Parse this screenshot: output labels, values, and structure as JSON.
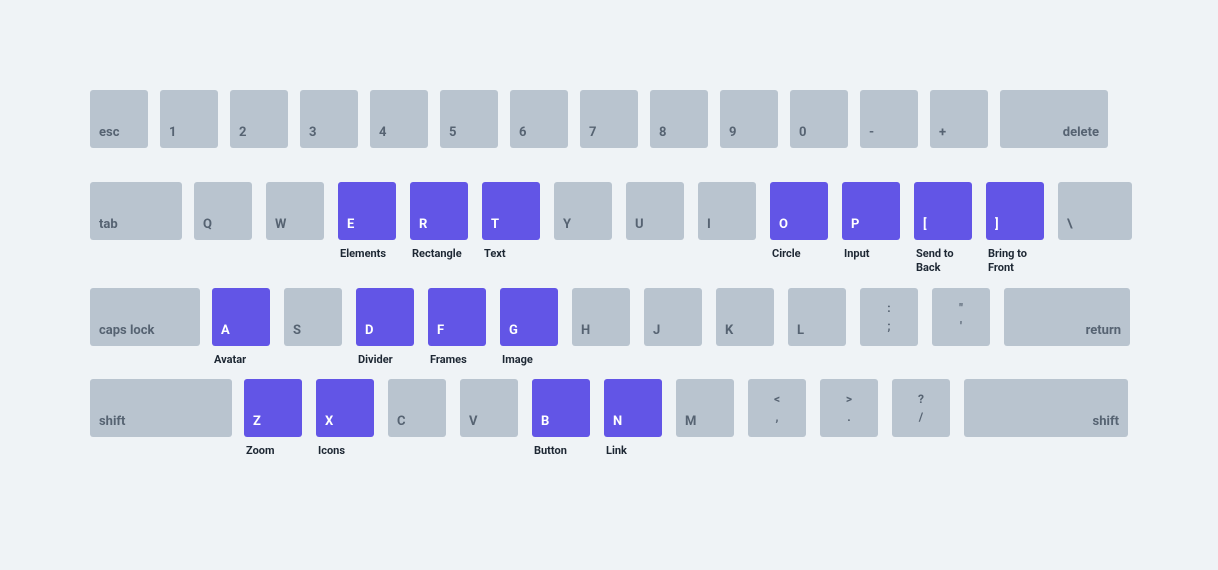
{
  "rows": [
    {
      "keys": [
        {
          "id": "esc",
          "cap": "esc",
          "width": 58,
          "active": false,
          "action": ""
        },
        {
          "id": "1",
          "cap": "1",
          "width": 58,
          "active": false,
          "action": ""
        },
        {
          "id": "2",
          "cap": "2",
          "width": 58,
          "active": false,
          "action": ""
        },
        {
          "id": "3",
          "cap": "3",
          "width": 58,
          "active": false,
          "action": ""
        },
        {
          "id": "4",
          "cap": "4",
          "width": 58,
          "active": false,
          "action": ""
        },
        {
          "id": "5",
          "cap": "5",
          "width": 58,
          "active": false,
          "action": ""
        },
        {
          "id": "6",
          "cap": "6",
          "width": 58,
          "active": false,
          "action": ""
        },
        {
          "id": "7",
          "cap": "7",
          "width": 58,
          "active": false,
          "action": ""
        },
        {
          "id": "8",
          "cap": "8",
          "width": 58,
          "active": false,
          "action": ""
        },
        {
          "id": "9",
          "cap": "9",
          "width": 58,
          "active": false,
          "action": ""
        },
        {
          "id": "0",
          "cap": "0",
          "width": 58,
          "active": false,
          "action": ""
        },
        {
          "id": "minus",
          "cap": "-",
          "width": 58,
          "active": false,
          "action": ""
        },
        {
          "id": "plus",
          "cap": "+",
          "width": 58,
          "active": false,
          "action": ""
        },
        {
          "id": "delete",
          "cap": "delete",
          "width": 108,
          "active": false,
          "action": "",
          "alignRight": true
        }
      ]
    },
    {
      "keys": [
        {
          "id": "tab",
          "cap": "tab",
          "width": 92,
          "active": false,
          "action": ""
        },
        {
          "id": "Q",
          "cap": "Q",
          "width": 58,
          "active": false,
          "action": ""
        },
        {
          "id": "W",
          "cap": "W",
          "width": 58,
          "active": false,
          "action": ""
        },
        {
          "id": "E",
          "cap": "E",
          "width": 58,
          "active": true,
          "action": "Elements"
        },
        {
          "id": "R",
          "cap": "R",
          "width": 58,
          "active": true,
          "action": "Rectangle"
        },
        {
          "id": "T",
          "cap": "T",
          "width": 58,
          "active": true,
          "action": "Text"
        },
        {
          "id": "Y",
          "cap": "Y",
          "width": 58,
          "active": false,
          "action": ""
        },
        {
          "id": "U",
          "cap": "U",
          "width": 58,
          "active": false,
          "action": ""
        },
        {
          "id": "I",
          "cap": "I",
          "width": 58,
          "active": false,
          "action": ""
        },
        {
          "id": "O",
          "cap": "O",
          "width": 58,
          "active": true,
          "action": "Circle"
        },
        {
          "id": "P",
          "cap": "P",
          "width": 58,
          "active": true,
          "action": "Input"
        },
        {
          "id": "bracket-open",
          "cap": "[",
          "width": 58,
          "active": true,
          "action": "Send to Back"
        },
        {
          "id": "bracket-close",
          "cap": "]",
          "width": 58,
          "active": true,
          "action": "Bring to Front"
        },
        {
          "id": "backslash",
          "cap": "\\",
          "width": 74,
          "active": false,
          "action": ""
        }
      ]
    },
    {
      "keys": [
        {
          "id": "caps-lock",
          "cap": "caps lock",
          "width": 110,
          "active": false,
          "action": ""
        },
        {
          "id": "A",
          "cap": "A",
          "width": 58,
          "active": true,
          "action": "Avatar"
        },
        {
          "id": "S",
          "cap": "S",
          "width": 58,
          "active": false,
          "action": ""
        },
        {
          "id": "D",
          "cap": "D",
          "width": 58,
          "active": true,
          "action": "Divider"
        },
        {
          "id": "F",
          "cap": "F",
          "width": 58,
          "active": true,
          "action": "Frames"
        },
        {
          "id": "G",
          "cap": "G",
          "width": 58,
          "active": true,
          "action": "Image"
        },
        {
          "id": "H",
          "cap": "H",
          "width": 58,
          "active": false,
          "action": ""
        },
        {
          "id": "J",
          "cap": "J",
          "width": 58,
          "active": false,
          "action": ""
        },
        {
          "id": "K",
          "cap": "K",
          "width": 58,
          "active": false,
          "action": ""
        },
        {
          "id": "L",
          "cap": "L",
          "width": 58,
          "active": false,
          "action": ""
        },
        {
          "id": "semicolon",
          "cap": ":\n;",
          "width": 58,
          "active": false,
          "action": "",
          "stacked": true
        },
        {
          "id": "quote",
          "cap": "\"\n'",
          "width": 58,
          "active": false,
          "action": "",
          "stacked": true
        },
        {
          "id": "return",
          "cap": "return",
          "width": 126,
          "active": false,
          "action": "",
          "alignRight": true
        }
      ]
    },
    {
      "keys": [
        {
          "id": "shift-left",
          "cap": "shift",
          "width": 142,
          "active": false,
          "action": ""
        },
        {
          "id": "Z",
          "cap": "Z",
          "width": 58,
          "active": true,
          "action": "Zoom"
        },
        {
          "id": "X",
          "cap": "X",
          "width": 58,
          "active": true,
          "action": "Icons"
        },
        {
          "id": "C",
          "cap": "C",
          "width": 58,
          "active": false,
          "action": ""
        },
        {
          "id": "V",
          "cap": "V",
          "width": 58,
          "active": false,
          "action": ""
        },
        {
          "id": "B",
          "cap": "B",
          "width": 58,
          "active": true,
          "action": "Button"
        },
        {
          "id": "N",
          "cap": "N",
          "width": 58,
          "active": true,
          "action": "Link"
        },
        {
          "id": "M",
          "cap": "M",
          "width": 58,
          "active": false,
          "action": ""
        },
        {
          "id": "comma",
          "cap": "<\n,",
          "width": 58,
          "active": false,
          "action": "",
          "stacked": true
        },
        {
          "id": "period",
          "cap": ">\n.",
          "width": 58,
          "active": false,
          "action": "",
          "stacked": true
        },
        {
          "id": "slash",
          "cap": "?\n/",
          "width": 58,
          "active": false,
          "action": "",
          "stacked": true
        },
        {
          "id": "shift-right",
          "cap": "shift",
          "width": 164,
          "active": false,
          "action": "",
          "alignRight": true
        }
      ]
    }
  ]
}
